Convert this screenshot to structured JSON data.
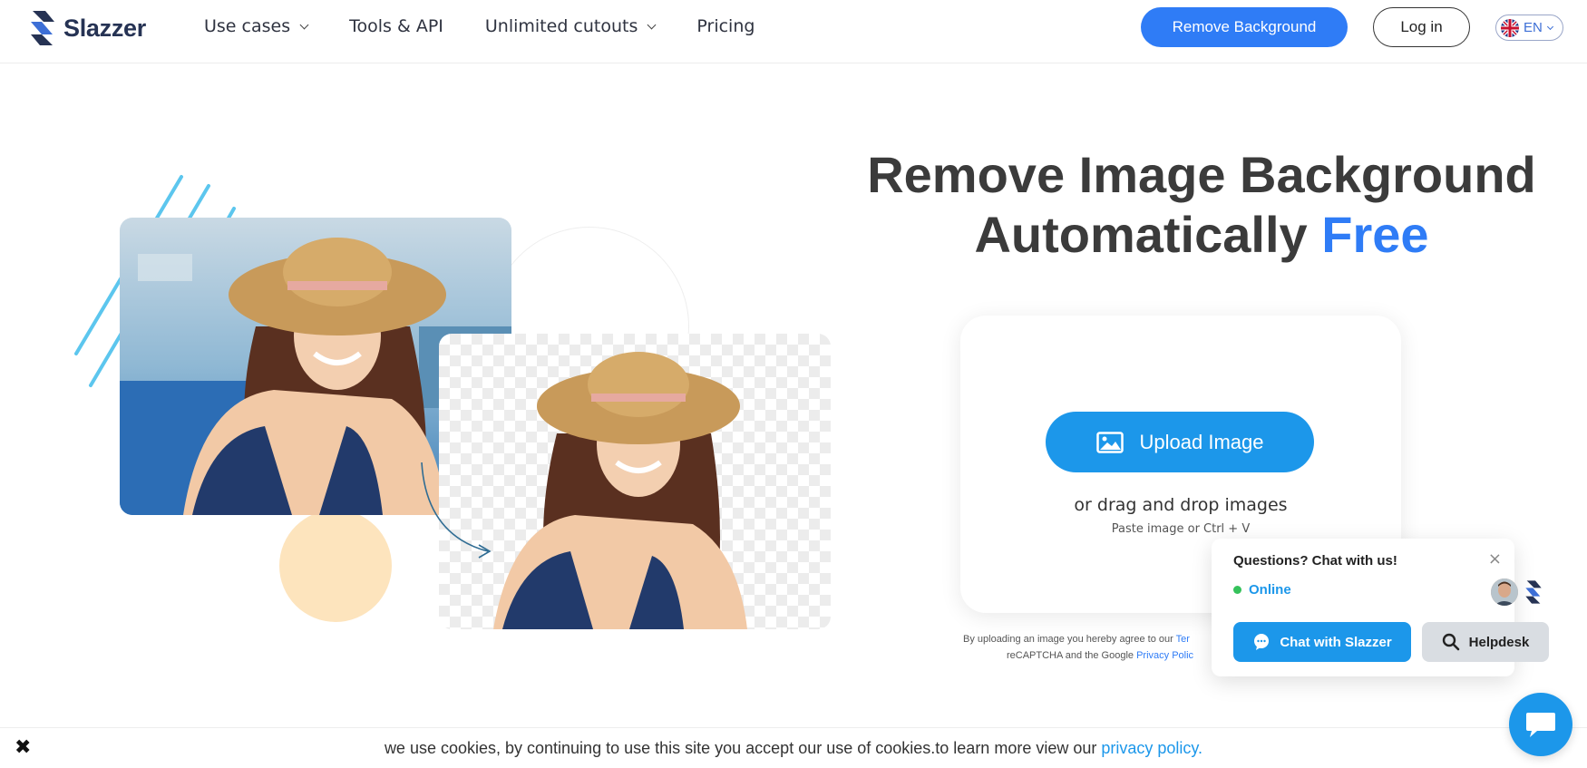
{
  "header": {
    "logo_text": "Slazzer",
    "nav": [
      {
        "label": "Use cases",
        "has_dropdown": true
      },
      {
        "label": "Tools & API",
        "has_dropdown": false
      },
      {
        "label": "Unlimited cutouts",
        "has_dropdown": true
      },
      {
        "label": "Pricing",
        "has_dropdown": false
      }
    ],
    "remove_background_label": "Remove Background",
    "login_label": "Log in",
    "language": "EN"
  },
  "hero": {
    "title_line1": "Remove Image Background",
    "title_line2_prefix": "Automatically ",
    "title_line2_highlight": "Free"
  },
  "upload": {
    "button_label": "Upload Image",
    "drag_text": "or drag and drop images",
    "paste_text": "Paste image or Ctrl + V",
    "legal_line1_prefix": "By uploading an image you hereby agree to our ",
    "legal_line1_link": "Ter",
    "legal_line2_prefix": "reCAPTCHA and the Google ",
    "legal_line2_link": "Privacy Polic"
  },
  "chat": {
    "title": "Questions? Chat with us!",
    "close_glyph": "×",
    "status": "Online",
    "chat_button": "Chat with Slazzer",
    "helpdesk_button": "Helpdesk"
  },
  "cookie": {
    "close_glyph": "✖",
    "text": "we use cookies, by continuing to use this site you accept our use of cookies.to learn more view our ",
    "link": "privacy policy."
  },
  "colors": {
    "brand_blue": "#2f7cf6",
    "upload_blue": "#1c97ea",
    "title_dark": "#3b3b3b",
    "online_green": "#35c25b"
  }
}
